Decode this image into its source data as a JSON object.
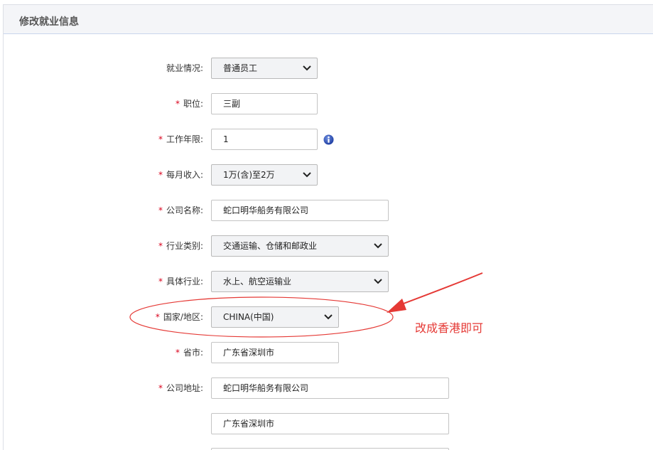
{
  "panel": {
    "title": "修改就业信息"
  },
  "form": {
    "required_mark": "*",
    "employment_status": {
      "label": "就业情况:",
      "value": "普通员工"
    },
    "position": {
      "label": "职位:",
      "value": "三副"
    },
    "work_years": {
      "label": "工作年限:",
      "value": "1"
    },
    "monthly_income": {
      "label": "每月收入:",
      "value": "1万(含)至2万"
    },
    "company_name": {
      "label": "公司名称:",
      "value": "蛇口明华船务有限公司"
    },
    "industry_category": {
      "label": "行业类别:",
      "value": "交通运输、仓储和邮政业"
    },
    "specific_industry": {
      "label": "具体行业:",
      "value": "水上、航空运输业"
    },
    "country_region": {
      "label": "国家/地区:",
      "value": "CHINA(中国)"
    },
    "province_city": {
      "label": "省市:",
      "value": "广东省深圳市"
    },
    "company_address": {
      "label": "公司地址:",
      "line1": "蛇口明华船务有限公司",
      "line2": "广东省深圳市"
    }
  },
  "annotation": {
    "text": "改成香港即可",
    "color": "#e53935"
  },
  "icons": {
    "dropdown": "chevron-down-icon",
    "info": "info-icon"
  }
}
